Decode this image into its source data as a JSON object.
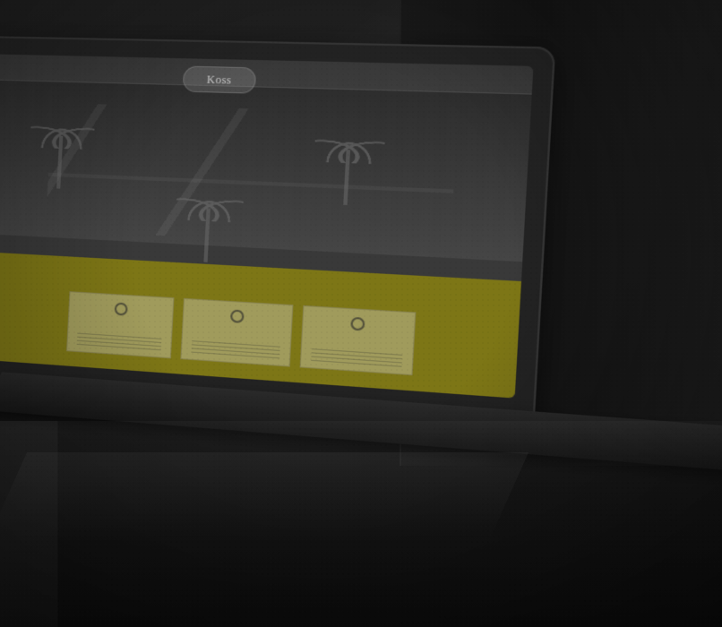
{
  "screen": {
    "logo_text": "Koss",
    "banner_text": "",
    "cards": [
      {
        "title": ""
      },
      {
        "title": ""
      },
      {
        "title": ""
      }
    ]
  },
  "colors": {
    "banner": "#7d7616",
    "background": "#181818"
  },
  "icons": {
    "card_icon": "circle-icon",
    "door_handle": "door-handle-icon"
  }
}
